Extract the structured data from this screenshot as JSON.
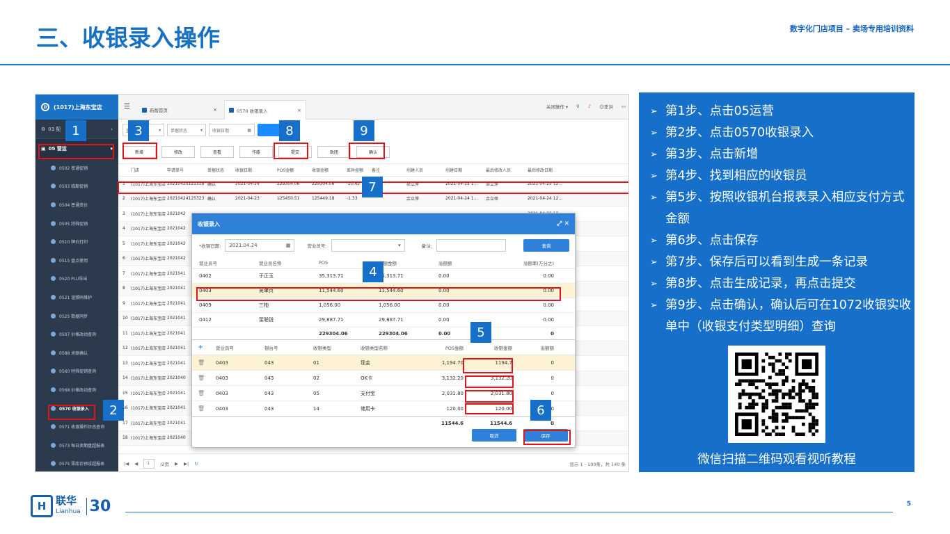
{
  "slide": {
    "title": "三、收银录入操作",
    "subtitle": "数字化门店项目 – 卖场专用培训资料",
    "page_number": "5"
  },
  "logo": {
    "cn": "联华",
    "en": "Lianhua",
    "anniv": "30"
  },
  "sidebar": {
    "store": "(1017)上海东宝店",
    "config": "03 配",
    "ops": "05 营运",
    "items": [
      "0502 普通促销",
      "0503 临期促销",
      "0504 普通变价",
      "0505 特殊促销",
      "0510 牌价打印",
      "0515 盘点使用",
      "0520 PLU导出",
      "0521 谊颁码维护",
      "0525 数据同步",
      "0507 价格改动查询",
      "0588 关联确认",
      "0560 特殊促销查询",
      "0568 价格改动查询",
      "0570 收银录入",
      "0571 收银操作日志查询",
      "0573 每日卖期盘超报表",
      "0575 零库存预设超报表"
    ]
  },
  "tabs": {
    "home": "新版首页",
    "current": "0570 收银录入",
    "close": "×"
  },
  "header": {
    "ops_label": "关闭操作 ▾",
    "user": "李洪"
  },
  "filters": {
    "store": "重店",
    "status": "单据状态",
    "date": "收银日期"
  },
  "toolbar": [
    "新增",
    "修改",
    "查看",
    "作废",
    "提交",
    "致团",
    "确认"
  ],
  "grid": {
    "columns": [
      "",
      "门店",
      "申请单号",
      "单据状态",
      "收银日期",
      "POS金额",
      "收银金额",
      "差异金额",
      "备注",
      "创建人员",
      "创建日期",
      "最后修改人员",
      "最后修改日期"
    ],
    "rows": [
      [
        "1",
        "(1017)上海东宝店",
        "20210425121318",
        "确认",
        "2021-04-24",
        "229304.06",
        "229304.06",
        "-20.62",
        "",
        "余立萍",
        "2021-04-25 1...",
        "余立萍",
        "2021-04-25 12..."
      ],
      [
        "2",
        "(1017)上海东宝店",
        "20210424125323",
        "确认",
        "2021-04-23",
        "125450.51",
        "125449.18",
        "-1.33",
        "",
        "余立萍",
        "2021-04-24 1...",
        "余立萍",
        "2021-04-24 12..."
      ],
      [
        "3",
        "(1017)上海东宝店",
        "2021042",
        "",
        "",
        "",
        "",
        "",
        "",
        "",
        "",
        "",
        "2021-04-23 12..."
      ],
      [
        "4",
        "(1017)上海东宝店",
        "2021042",
        "",
        "",
        "",
        "",
        "",
        "",
        "",
        "",
        "",
        "2021-04-22 12..."
      ],
      [
        "5",
        "(1017)上海东宝店",
        "2021042",
        "",
        "",
        "",
        "",
        "",
        "",
        "",
        "",
        "",
        "2021-04-21 11..."
      ],
      [
        "6",
        "(1017)上海东宝店",
        "2021042",
        "",
        "",
        "",
        "",
        "",
        "",
        "",
        "",
        "",
        "2021-04-20 13..."
      ],
      [
        "7",
        "(1017)上海东宝店",
        "2021041",
        "",
        "",
        "",
        "",
        "",
        "",
        "",
        "",
        "",
        "2021-04-19 13..."
      ],
      [
        "8",
        "(1017)上海东宝店",
        "2021041",
        "",
        "",
        "",
        "",
        "",
        "",
        "",
        "",
        "",
        "2021-04-18 12..."
      ],
      [
        "9",
        "(1017)上海东宝店",
        "2021041",
        "",
        "",
        "",
        "",
        "",
        "",
        "",
        "",
        "",
        "2021-04-17 10..."
      ],
      [
        "10",
        "(1017)上海东宝店",
        "2021041",
        "",
        "",
        "",
        "",
        "",
        "",
        "",
        "",
        "",
        "2021-04-16 12..."
      ],
      [
        "11",
        "(1017)上海东宝店",
        "2021041",
        "",
        "",
        "",
        "",
        "",
        "",
        "",
        "",
        "",
        "2021-04-15 11..."
      ],
      [
        "12",
        "(1017)上海东宝店",
        "2021041",
        "",
        "",
        "",
        "",
        "",
        "",
        "",
        "",
        "",
        "2021-04-14 15..."
      ],
      [
        "13",
        "(1017)上海东宝店",
        "2021041",
        "",
        "",
        "",
        "",
        "",
        "",
        "",
        "",
        "",
        "2021-04-13 12..."
      ],
      [
        "14",
        "(1017)上海东宝店",
        "2021040",
        "",
        "",
        "",
        "",
        "",
        "",
        "",
        "",
        "",
        "2021-04-13 08..."
      ],
      [
        "15",
        "(1017)上海东宝店",
        "2021041",
        "",
        "",
        "",
        "",
        "",
        "",
        "",
        "",
        "",
        "2021-04-12 13..."
      ],
      [
        "16",
        "(1017)上海东宝店",
        "2021041",
        "",
        "",
        "",
        "",
        "",
        "",
        "",
        "",
        "",
        "2021-04-11 11..."
      ],
      [
        "17",
        "(1017)上海东宝店",
        "2021041",
        "",
        "",
        "",
        "",
        "",
        "",
        "",
        "",
        "",
        "2021-04-10 12..."
      ],
      [
        "18",
        "(1017)上海东宝店",
        "2021040",
        "",
        "",
        "",
        "",
        "",
        "",
        "",
        "",
        "",
        "2021-04-09 13..."
      ]
    ]
  },
  "pager": {
    "page": "1",
    "total_pages": "/2页",
    "info": "显示 1 - 100条，共 140 条"
  },
  "dialog": {
    "title": "收银录入",
    "date_label": "*收银日期:",
    "date_value": "2021.04.24",
    "cashier_label": "营业员号:",
    "note_label": "备注:",
    "query": "查询",
    "cashier_columns": [
      "营业员号",
      "营业员名称",
      "POS",
      "收银金额",
      "溢额额",
      "溢额率(万分之)"
    ],
    "cashiers": [
      [
        "0402",
        "于正玉",
        "35,313.71",
        "35,313.71",
        "0.00",
        "0.00"
      ],
      [
        "0403",
        "吴聿贞",
        "11,544.60",
        "11,544.60",
        "0.00",
        "0.00"
      ],
      [
        "0409",
        "三柚",
        "1,056.00",
        "1,056.00",
        "0.00",
        "0.00"
      ],
      [
        "0412",
        "葉聪锐",
        "29,887.71",
        "29,887.71",
        "0.00",
        "0.00"
      ]
    ],
    "cashier_total": [
      "",
      "",
      "229304.06",
      "229304.06",
      "0.00",
      "0"
    ],
    "pay_columns": [
      "+",
      "营业员号",
      "银台号",
      "收银类型",
      "收银类型名称",
      "POS金额",
      "收银金额",
      "溢额额"
    ],
    "payments": [
      [
        "0403",
        "043",
        "01",
        "现金",
        "1,194.70",
        "1194.7",
        "0"
      ],
      [
        "0403",
        "043",
        "02",
        "OK卡",
        "3,132.20",
        "3,132.20",
        "0"
      ],
      [
        "0403",
        "043",
        "05",
        "支付宝",
        "2,031.80",
        "2,031.80",
        "0"
      ],
      [
        "0403",
        "043",
        "14",
        "储用卡",
        "120.00",
        "120.00",
        "0"
      ]
    ],
    "pay_total": [
      "11544.6",
      "11544.6",
      "0"
    ],
    "cancel": "取消",
    "save": "保存"
  },
  "badges": [
    "1",
    "2",
    "3",
    "4",
    "5",
    "6",
    "7",
    "8",
    "9"
  ],
  "steps": [
    "第1步、点击05运营",
    "第2步、点击0570收银录入",
    "第3步、点击新增",
    "第4步、找到相应的收银员",
    "第5步、按照收银机台报表录入相应支付方式金额",
    "第6步、点击保存",
    "第7步、保存后可以看到生成一条记录",
    "第8步、点击生成记录，再点击提交",
    "第9步、点击确认，确认后可在1072收银实收单中（收银支付类型明细）查询"
  ],
  "qr_caption": "微信扫描二维码观看视听教程"
}
